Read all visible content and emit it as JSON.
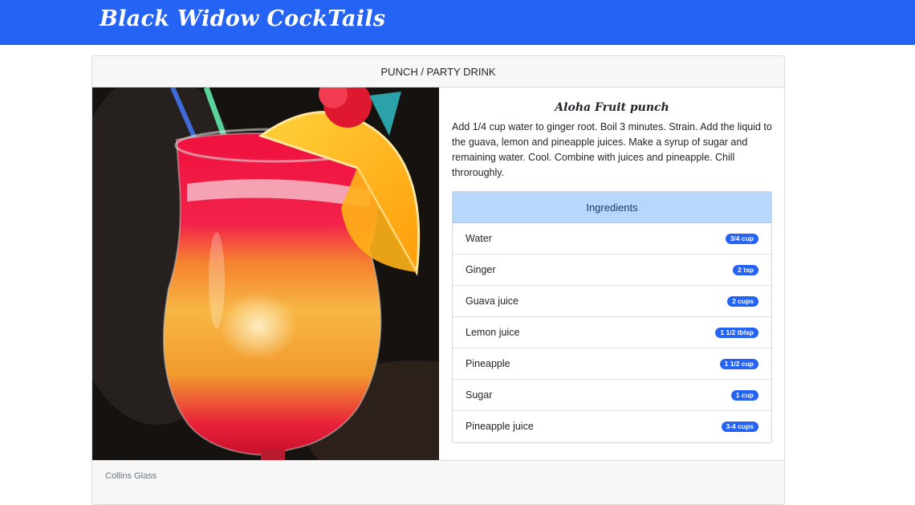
{
  "navbar": {
    "brand": "Black Widow CockTails",
    "color": "#2563f5"
  },
  "card": {
    "category": "PUNCH / PARTY DRINK",
    "glass": "Collins Glass"
  },
  "drink": {
    "name": "Aloha Fruit punch",
    "instructions": "Add 1/4 cup water to ginger root. Boil 3 minutes. Strain. Add the liquid to the guava, lemon and pineapple juices. Make a syrup of sugar and remaining water. Cool. Combine with juices and pineapple. Chill throroughly."
  },
  "ingredients": {
    "header": "Ingredients",
    "header_color": "#b8d8fb",
    "badge_color": "#2563f5",
    "items": [
      {
        "name": "Water",
        "measure": "3/4 cup"
      },
      {
        "name": "Ginger",
        "measure": "2 tsp"
      },
      {
        "name": "Guava juice",
        "measure": "2 cups"
      },
      {
        "name": "Lemon juice",
        "measure": "1 1/2 tblsp"
      },
      {
        "name": "Pineapple",
        "measure": "1 1/2 cup"
      },
      {
        "name": "Sugar",
        "measure": "1 cup"
      },
      {
        "name": "Pineapple juice",
        "measure": "3-4 cups"
      }
    ]
  }
}
